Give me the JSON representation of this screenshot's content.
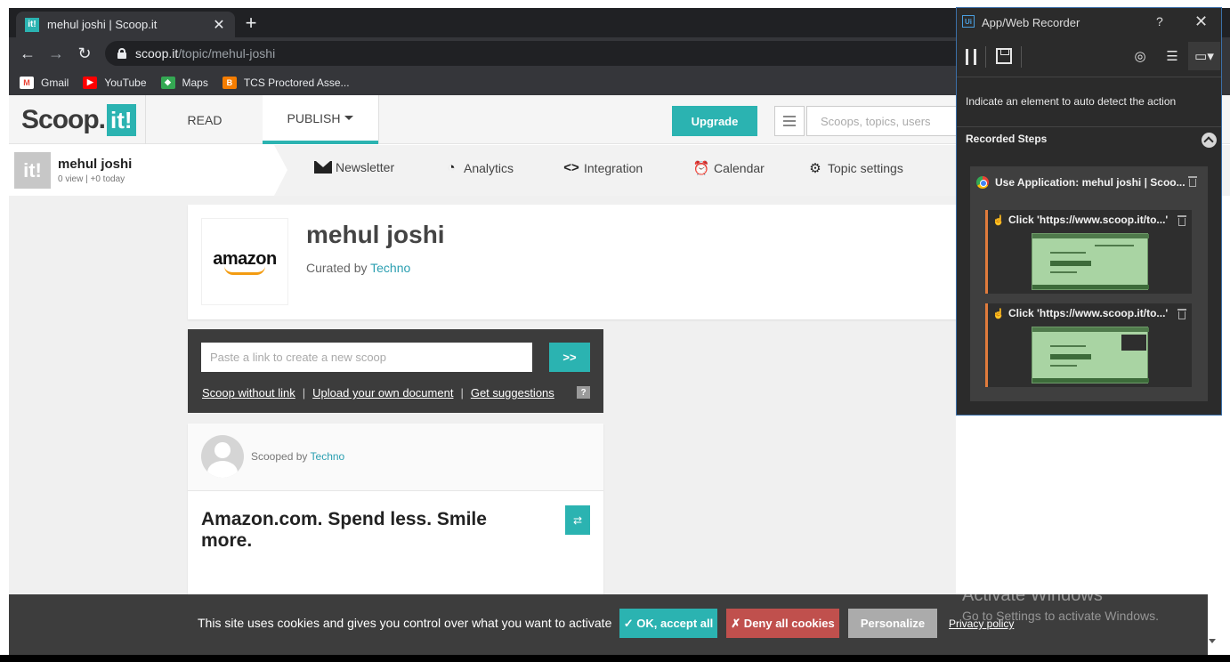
{
  "browser": {
    "tab_title": "mehul joshi | Scoop.it",
    "tab_favicon": "it!",
    "url_host": "scoop.it",
    "url_path": "/topic/mehul-joshi",
    "bookmarks": [
      {
        "label": "Gmail",
        "icon": "gmail-icon",
        "color": "#ea4335",
        "glyph": "M"
      },
      {
        "label": "YouTube",
        "icon": "youtube-icon",
        "color": "#ff0000",
        "glyph": "▶"
      },
      {
        "label": "Maps",
        "icon": "maps-icon",
        "color": "#34a853",
        "glyph": "◆"
      },
      {
        "label": "TCS Proctored Asse...",
        "icon": "blogger-icon",
        "color": "#f57d00",
        "glyph": "B"
      }
    ]
  },
  "site": {
    "logo_text": "Scoop.",
    "logo_box": "it!",
    "nav_read": "READ",
    "nav_publish": "PUBLISH",
    "upgrade": "Upgrade",
    "search_placeholder": "Scoops, topics, users",
    "accent": "#2bb3b1"
  },
  "topic": {
    "logo": "it!",
    "name": "mehul joshi",
    "stats": "0 view | +0 today",
    "nav": {
      "newsletter": "Newsletter",
      "analytics": "Analytics",
      "integration": "Integration",
      "calendar": "Calendar",
      "settings": "Topic settings"
    }
  },
  "card": {
    "image_word": "amazon",
    "title": "mehul joshi",
    "curated_prefix": "Curated by",
    "curator": "Techno"
  },
  "scoop": {
    "placeholder": "Paste a link to create a new scoop",
    "go": ">>",
    "link_without": "Scoop without link",
    "link_upload": "Upload your own document",
    "link_suggestions": "Get suggestions",
    "sep": "|",
    "help": "?"
  },
  "post": {
    "scooped_prefix": "Scooped by",
    "scooper": "Techno",
    "title": "Amazon.com. Spend less. Smile more.",
    "rescoop_icon": "⇄"
  },
  "recorder": {
    "logo": "Ui",
    "title": "App/Web Recorder",
    "help": "?",
    "close": "✕",
    "hint": "Indicate an element to auto detect the action",
    "steps_label": "Recorded Steps",
    "group_title": "Use Application: mehul joshi | Scoo...",
    "steps": [
      {
        "title": "Click 'https://www.scoop.it/to...'"
      },
      {
        "title": "Click 'https://www.scoop.it/to...'"
      }
    ]
  },
  "cookie": {
    "text": "This site uses cookies and gives you control over what you want to activate",
    "accept": "✓ OK, accept all",
    "deny": "✗ Deny all cookies",
    "personalize": "Personalize",
    "privacy": "Privacy policy"
  },
  "watermark": {
    "title": "Activate Windows",
    "sub": "Go to Settings to activate Windows."
  }
}
